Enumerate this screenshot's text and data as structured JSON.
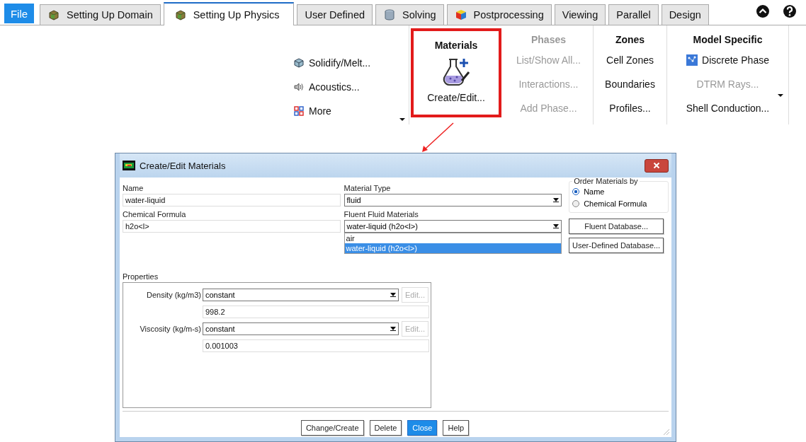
{
  "file_tab": {
    "label": "File"
  },
  "tabs": [
    {
      "label": "Setting Up Domain",
      "selected": false,
      "kind": "domain"
    },
    {
      "label": "Setting Up Physics",
      "selected": true,
      "kind": "physics"
    },
    {
      "label": "User Defined",
      "selected": false,
      "kind": "plain"
    },
    {
      "label": "Solving",
      "selected": false,
      "kind": "solving"
    },
    {
      "label": "Postprocessing",
      "selected": false,
      "kind": "post"
    },
    {
      "label": "Viewing",
      "selected": false,
      "kind": "plain"
    },
    {
      "label": "Parallel",
      "selected": false,
      "kind": "plain"
    },
    {
      "label": "Design",
      "selected": false,
      "kind": "plain"
    }
  ],
  "ribbon": [
    {
      "kind": "small",
      "dropdown": true,
      "items": [
        {
          "label": "Solidify/Melt...",
          "kind": "solidify",
          "disabled": false
        },
        {
          "label": "Acoustics...",
          "kind": "acoustics",
          "disabled": false
        },
        {
          "label": "More",
          "kind": "more",
          "disabled": false
        }
      ]
    },
    {
      "kind": "large",
      "title": "Materials",
      "title_disabled": false,
      "highlighted": true,
      "button": {
        "label": "Create/Edit..."
      }
    },
    {
      "kind": "small",
      "title": "Phases",
      "title_disabled": true,
      "items": [
        {
          "label": "List/Show All...",
          "disabled": true
        },
        {
          "label": "Interactions...",
          "disabled": true
        },
        {
          "label": "Add Phase...",
          "disabled": true
        }
      ]
    },
    {
      "kind": "small",
      "title": "Zones",
      "title_disabled": false,
      "items": [
        {
          "label": "Cell Zones",
          "disabled": false
        },
        {
          "label": "Boundaries",
          "disabled": false
        },
        {
          "label": "Profiles...",
          "disabled": false
        }
      ]
    },
    {
      "kind": "small",
      "title": "Model Specific",
      "title_disabled": false,
      "dropdown": true,
      "items": [
        {
          "label": "Discrete Phase",
          "kind": "discrete",
          "disabled": false
        },
        {
          "label": "DTRM Rays...",
          "disabled": true
        },
        {
          "label": "Shell Conduction...",
          "disabled": false
        }
      ]
    }
  ],
  "dialog": {
    "title": "Create/Edit Materials",
    "name": {
      "label": "Name",
      "value": "water-liquid"
    },
    "chemical_formula": {
      "label": "Chemical Formula",
      "value": "h2o<l>"
    },
    "material_type": {
      "label": "Material Type",
      "value": "fluid"
    },
    "fluent_materials": {
      "label": "Fluent Fluid Materials",
      "value": "water-liquid (h2o<l>)",
      "expanded": true,
      "options": [
        {
          "label": "air",
          "selected": false
        },
        {
          "label": "water-liquid (h2o<l>)",
          "selected": true
        }
      ]
    },
    "order_by": {
      "title": "Order Materials by",
      "options": [
        {
          "label": "Name",
          "selected": true
        },
        {
          "label": "Chemical Formula",
          "selected": false
        }
      ]
    },
    "database_buttons": [
      "Fluent Database...",
      "User-Defined Database..."
    ],
    "properties": {
      "title": "Properties",
      "rows": [
        {
          "label": "Density (kg/m3)",
          "method": "constant",
          "edit": "Edit...",
          "edit_disabled": true,
          "value": "998.2"
        },
        {
          "label": "Viscosity (kg/m-s)",
          "method": "constant",
          "edit": "Edit...",
          "edit_disabled": true,
          "value": "0.001003"
        }
      ]
    },
    "buttons": [
      {
        "label": "Change/Create",
        "primary": false
      },
      {
        "label": "Delete",
        "primary": false
      },
      {
        "label": "Close",
        "primary": true
      },
      {
        "label": "Help",
        "primary": false
      }
    ]
  }
}
